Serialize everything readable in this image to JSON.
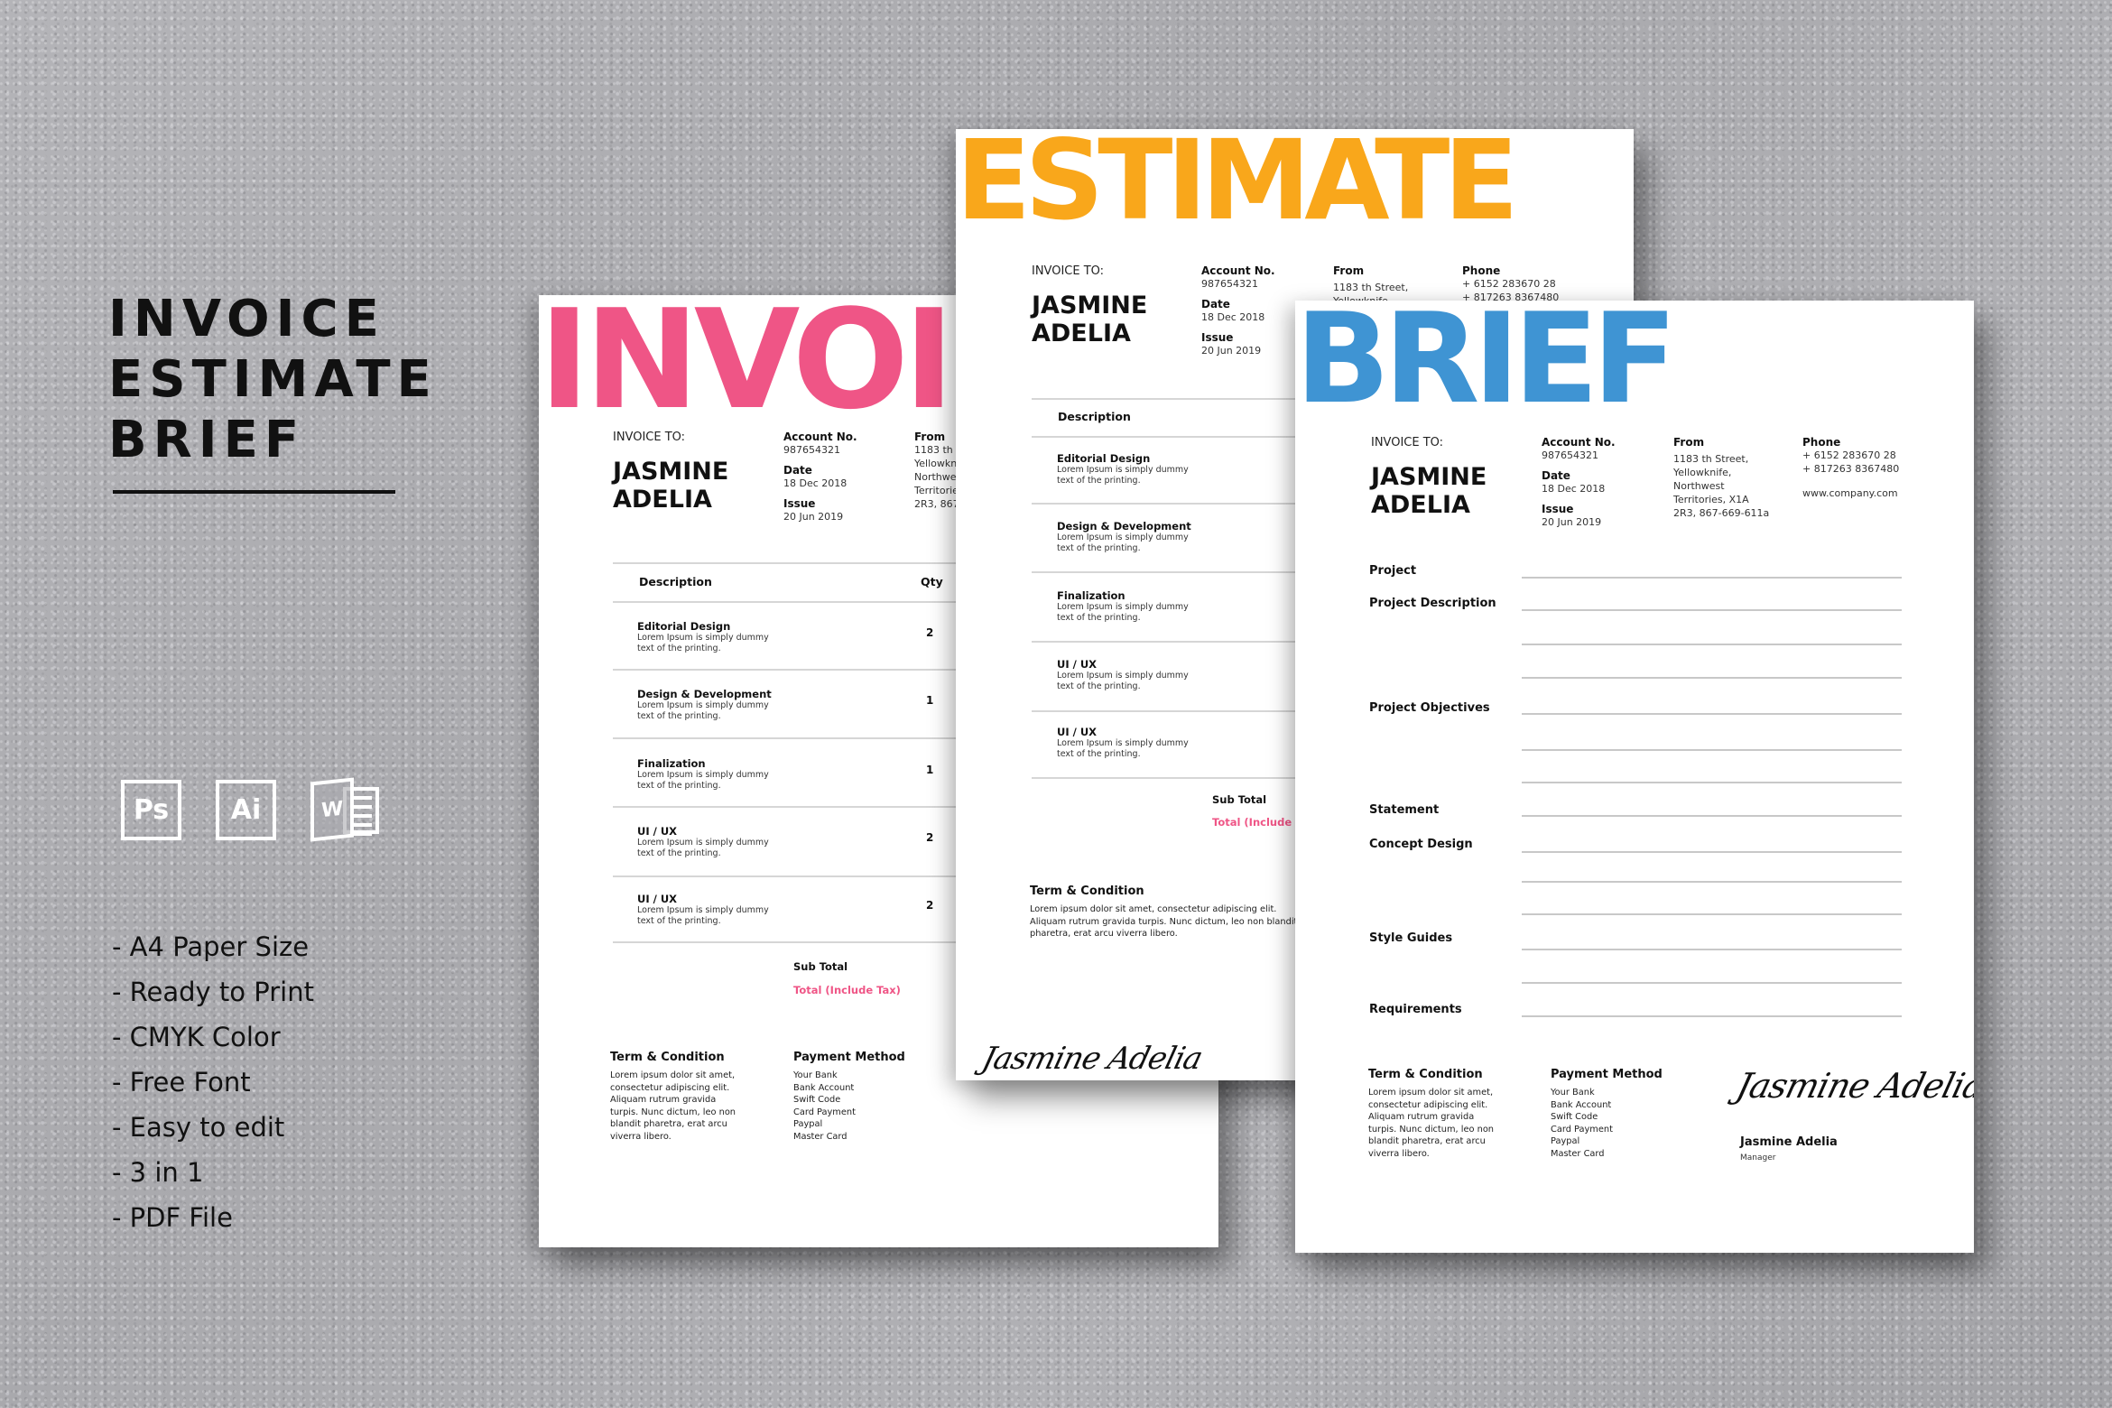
{
  "promo": {
    "title_lines": [
      "INVOICE",
      "ESTIMATE",
      "BRIEF"
    ],
    "app_icons": [
      {
        "name": "photoshop-icon",
        "label": "Ps"
      },
      {
        "name": "illustrator-icon",
        "label": "Ai"
      },
      {
        "name": "word-icon",
        "label": "W"
      }
    ],
    "features": [
      "- A4 Paper Size",
      "- Ready to Print",
      "- CMYK Color",
      "- Free Font",
      "- Easy to edit",
      "- 3 in 1",
      "- PDF File"
    ]
  },
  "colors": {
    "invoice_accent": "#ef5586",
    "estimate_accent": "#f9a71b",
    "brief_accent": "#3f94d3",
    "total_label": "#ef5586"
  },
  "common": {
    "invoice_to": "INVOICE TO:",
    "client_first": "JASMINE",
    "client_last": "ADELIA",
    "account_label": "Account No.",
    "account_value": "987654321",
    "date_label": "Date",
    "date_value": "18 Dec 2018",
    "issue_label": "Issue",
    "issue_value": "20 Jun 2019",
    "from_label": "From",
    "from_lines": [
      "1183  th Street,",
      "Yellowknife,",
      "Northwest",
      "Territories, X1A",
      "2R3, 867-669-611a"
    ],
    "phone_label": "Phone",
    "phone_lines": [
      "+ 6152 283670 28",
      "+ 817263 8367480"
    ],
    "website": "www.company.com",
    "table_desc_header": "Description",
    "table_qty_header": "Qty",
    "items": [
      {
        "title": "Editorial Design",
        "desc1": "Lorem Ipsum is simply dummy",
        "desc2": "text of the printing.",
        "qty": "2"
      },
      {
        "title": "Design & Development",
        "desc1": "Lorem Ipsum is simply dummy",
        "desc2": "text of the printing.",
        "qty": "1"
      },
      {
        "title": "Finalization",
        "desc1": "Lorem Ipsum is simply dummy",
        "desc2": "text of the printing.",
        "qty": "1"
      },
      {
        "title": "UI / UX",
        "desc1": "Lorem Ipsum is simply dummy",
        "desc2": "text of the printing.",
        "qty": "2"
      },
      {
        "title": "UI / UX",
        "desc1": "Lorem Ipsum is simply dummy",
        "desc2": "text of the printing.",
        "qty": "2"
      }
    ],
    "sub_total": "Sub Total",
    "total": "Total (Include Tax)",
    "terms_heading": "Term & Condition",
    "terms_lines": [
      "Lorem ipsum dolor sit amet,",
      "consectetur adipiscing elit.",
      "Aliquam rutrum gravida",
      "turpis. Nunc dictum, leo non",
      "blandit pharetra, erat arcu",
      "viverra libero."
    ],
    "terms_wide_lines": [
      "Lorem ipsum dolor sit amet, consectetur adipiscing elit.",
      "Aliquam rutrum gravida turpis. Nunc dictum, leo non blandit",
      "pharetra, erat arcu viverra libero."
    ],
    "payment_heading": "Payment Method",
    "payment_lines": [
      "Your Bank",
      "Bank Account",
      "Swift Code",
      "Card Payment",
      "Paypal",
      "Master Card"
    ],
    "signature": "Jasmine Adelia",
    "signer_name": "Jasmine Adelia",
    "signer_role": "Manager"
  },
  "invoice": {
    "heading": "INVOICE"
  },
  "estimate": {
    "heading": "ESTIMATE"
  },
  "brief": {
    "heading": "BRIEF",
    "fields": [
      "Project",
      "Project Description",
      "Project Objectives",
      "Statement",
      "Concept Design",
      "Style Guides",
      "Requirements"
    ]
  }
}
